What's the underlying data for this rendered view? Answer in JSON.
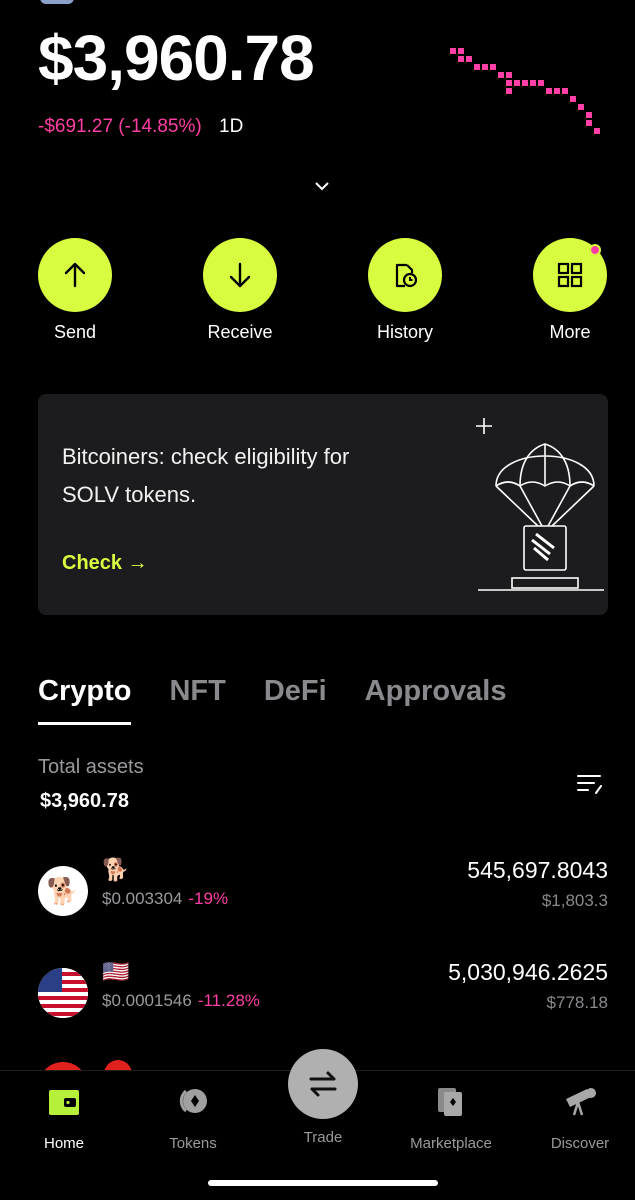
{
  "portfolio": {
    "balance": "$3,960.78",
    "change": "-$691.27 (-14.85%)",
    "period": "1D"
  },
  "actions": [
    {
      "label": "Send",
      "icon": "arrow-up-icon"
    },
    {
      "label": "Receive",
      "icon": "arrow-down-icon"
    },
    {
      "label": "History",
      "icon": "history-icon"
    },
    {
      "label": "More",
      "icon": "grid-icon"
    }
  ],
  "promo": {
    "text": "Bitcoiners: check eligibility for SOLV tokens.",
    "cta": "Check →",
    "art": "parachute-airdrop-icon"
  },
  "tabs": [
    "Crypto",
    "NFT",
    "DeFi",
    "Approvals"
  ],
  "total": {
    "label": "Total assets",
    "value": "$3,960.78"
  },
  "tokens": [
    {
      "emoji": "🐕",
      "price": "$0.003304",
      "change": "-19%",
      "amount": "545,697.8043",
      "value": "$1,803.3"
    },
    {
      "emoji": "🇺🇸",
      "price": "$0.0001546",
      "change": "-11.28%",
      "amount": "5,030,946.2625",
      "value": "$778.18"
    }
  ],
  "nav": {
    "home": "Home",
    "tokens": "Tokens",
    "trade": "Trade",
    "marketplace": "Marketplace",
    "discover": "Discover"
  },
  "colors": {
    "accent": "#d8fc3f",
    "negative": "#ff3fa3",
    "background": "#000000",
    "card": "#1c1c1e"
  }
}
